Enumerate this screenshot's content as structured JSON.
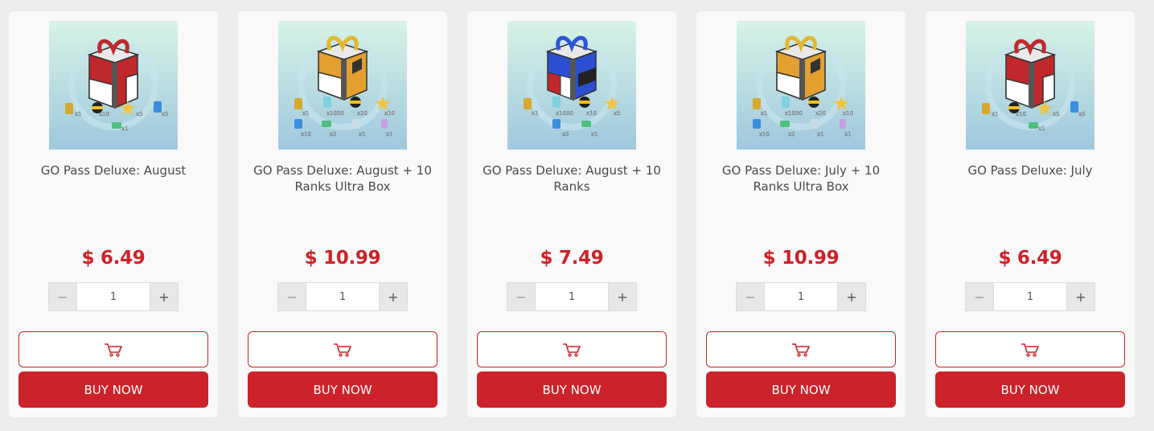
{
  "products": [
    {
      "title": "GO Pass Deluxe: August",
      "price": "$ 6.49",
      "quantity": "1",
      "minus_label": "−",
      "plus_label": "+",
      "buy_label": "BUY NOW",
      "ribbon_color": "#c0282c",
      "box_colors": [
        "#c0282c",
        "#ffffff"
      ],
      "item_labels": [
        "x1",
        "x10",
        "x5",
        "x5",
        "x1"
      ]
    },
    {
      "title": "GO Pass Deluxe: August + 10 Ranks Ultra Box",
      "price": "$ 10.99",
      "quantity": "1",
      "minus_label": "−",
      "plus_label": "+",
      "buy_label": "BUY NOW",
      "ribbon_color": "#e3b82e",
      "box_colors": [
        "#e3a030",
        "#ffffff"
      ],
      "item_labels": [
        "x1",
        "x1000",
        "x20",
        "x10",
        "x10",
        "x2",
        "x1",
        "x1"
      ]
    },
    {
      "title": "GO Pass Deluxe: August + 10 Ranks",
      "price": "$ 7.49",
      "quantity": "1",
      "minus_label": "−",
      "plus_label": "+",
      "buy_label": "BUY NOW",
      "ribbon_color": "#2b55d6",
      "box_colors": [
        "#2b4fd0",
        "#ffffff"
      ],
      "item_labels": [
        "x1",
        "x1000",
        "x10",
        "x5",
        "x5",
        "x1"
      ]
    },
    {
      "title": "GO Pass Deluxe: July + 10 Ranks Ultra Box",
      "price": "$ 10.99",
      "quantity": "1",
      "minus_label": "−",
      "plus_label": "+",
      "buy_label": "BUY NOW",
      "ribbon_color": "#e3b82e",
      "box_colors": [
        "#e3a030",
        "#ffffff"
      ],
      "item_labels": [
        "x1",
        "x1000",
        "x20",
        "x10",
        "x10",
        "x2",
        "x1",
        "x1"
      ]
    },
    {
      "title": "GO Pass Deluxe: July",
      "price": "$ 6.49",
      "quantity": "1",
      "minus_label": "−",
      "plus_label": "+",
      "buy_label": "BUY NOW",
      "ribbon_color": "#c0282c",
      "box_colors": [
        "#c0282c",
        "#ffffff"
      ],
      "item_labels": [
        "x1",
        "x10",
        "x5",
        "x5",
        "x1"
      ]
    }
  ],
  "colors": {
    "accent": "#cc2229",
    "card_bg": "#f9f9f9",
    "page_bg": "#ececec",
    "title_text": "#4a4a4a"
  },
  "icons": {
    "cart": "shopping-cart-icon",
    "product": "gift-box-icon"
  }
}
